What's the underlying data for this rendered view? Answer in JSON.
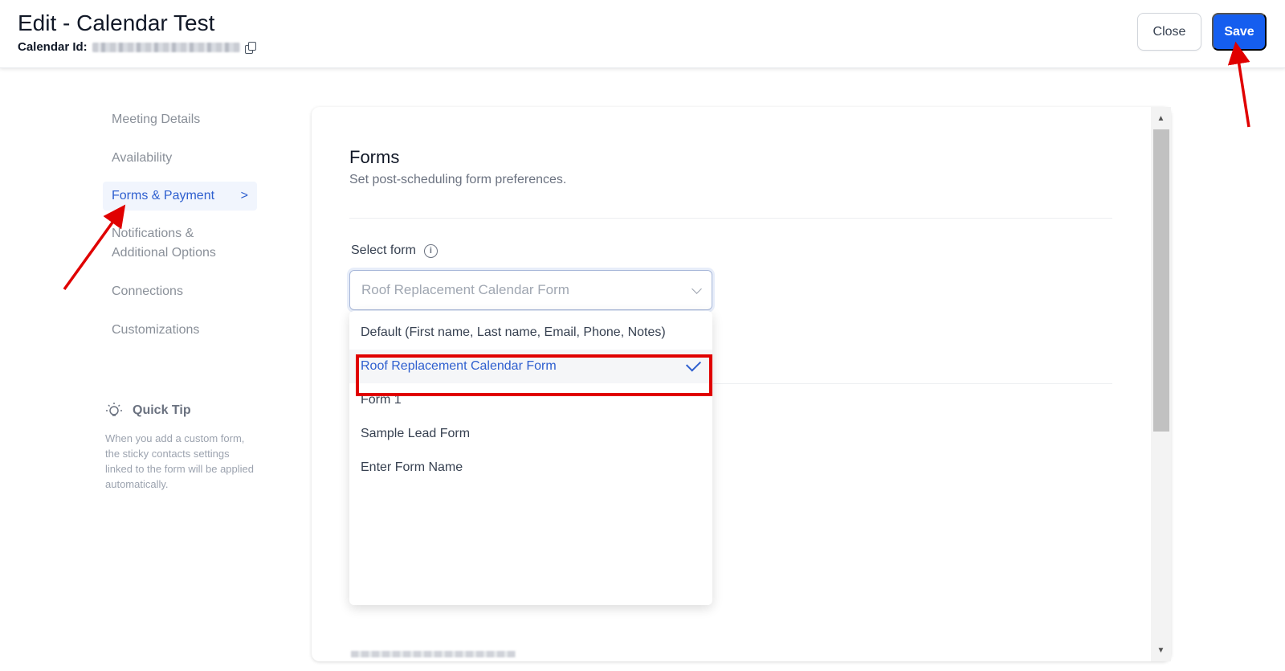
{
  "header": {
    "title": "Edit - Calendar Test",
    "calendar_id_label": "Calendar Id:",
    "close_label": "Close",
    "save_label": "Save"
  },
  "sidebar": {
    "items": [
      {
        "label": "Meeting Details",
        "active": false
      },
      {
        "label": "Availability",
        "active": false
      },
      {
        "label": "Forms & Payment",
        "active": true
      },
      {
        "label": "Notifications & Additional Options",
        "active": false
      },
      {
        "label": "Connections",
        "active": false
      },
      {
        "label": "Customizations",
        "active": false
      }
    ],
    "active_chevron": ">",
    "quick_tip": {
      "title": "Quick Tip",
      "text": "When you add a custom form, the sticky contacts settings linked to the form will be applied automatically."
    }
  },
  "main": {
    "section_title": "Forms",
    "section_subtitle": "Set post-scheduling form preferences.",
    "select_form": {
      "label": "Select form",
      "info_icon": "i",
      "value": "Roof Replacement Calendar Form",
      "options": [
        {
          "label": "Default (First name, Last name, Email, Phone, Notes)",
          "selected": false
        },
        {
          "label": "Roof Replacement Calendar Form",
          "selected": true
        },
        {
          "label": "Form 1",
          "selected": false
        },
        {
          "label": "Sample Lead Form",
          "selected": false
        },
        {
          "label": "Enter Form Name",
          "selected": false
        }
      ]
    }
  },
  "annotations": {
    "arrow_color": "#e00000",
    "highlight_color": "#e00000"
  },
  "colors": {
    "primary": "#155eef",
    "active_text": "#2e5fcf",
    "active_bg": "#f1f5fd"
  }
}
